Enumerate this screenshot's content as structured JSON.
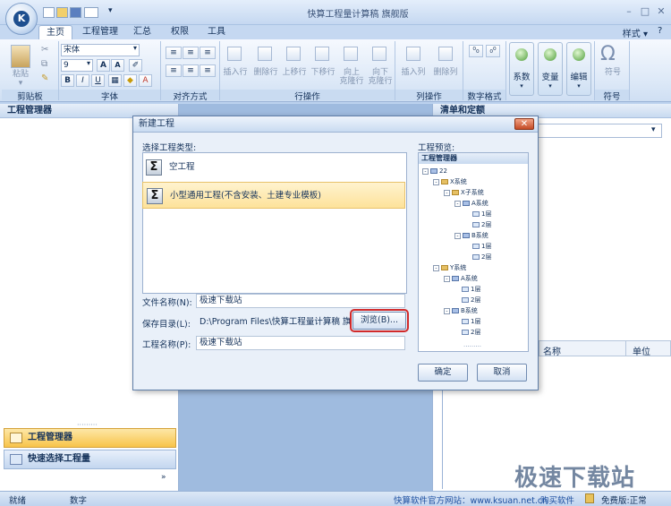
{
  "window": {
    "title": "快算工程量计算稿 旗舰版",
    "style_label": "样式"
  },
  "tabs": [
    "主页",
    "工程管理",
    "汇总",
    "权限",
    "工具"
  ],
  "ribbon": {
    "clipboard": {
      "paste": "粘贴",
      "group": "剪贴板"
    },
    "font": {
      "name": "宋体",
      "size": "9",
      "group": "字体"
    },
    "align": {
      "group": "对齐方式"
    },
    "rows": {
      "insert": "插入行",
      "delete": "删除行",
      "up": "上移行",
      "down": "下移行",
      "fill_up_1": "向上",
      "fill_up_2": "克隆行",
      "fill_down_1": "向下",
      "fill_down_2": "克隆行",
      "group": "行操作"
    },
    "cols": {
      "insert": "插入列",
      "delete": "删除列",
      "group": "列操作"
    },
    "numfmt": {
      "group": "数字格式"
    },
    "coef": "系数",
    "var": "变量",
    "edit": "编辑",
    "symbol": {
      "label": "符号",
      "group": "符号"
    }
  },
  "left_pane": {
    "title": "工程管理器",
    "nav1": "工程管理器",
    "nav2": "快速选择工程量"
  },
  "right_pane": {
    "title": "清单和定额",
    "col_name": "名称",
    "col_unit": "单位"
  },
  "dialog": {
    "title": "新建工程",
    "type_label": "选择工程类型:",
    "preview_label": "工程预览:",
    "types": [
      "空工程",
      "小型通用工程(不含安装、土建专业模板)"
    ],
    "file_label": "文件名称(N):",
    "file_value": "极速下载站",
    "dir_label": "保存目录(L):",
    "dir_value": "D:\\Program Files\\快算工程量计算稿 旗舰",
    "browse": "浏览(B)...",
    "proj_label": "工程名称(P):",
    "proj_value": "极速下载站",
    "ok": "确定",
    "cancel": "取消"
  },
  "tree": {
    "header": "工程管理器",
    "nodes": [
      "22",
      "X系统",
      "X子系统",
      "A系统",
      "1层",
      "2层",
      "B系统",
      "1层",
      "2层",
      "Y系统",
      "A系统",
      "1层",
      "2层",
      "B系统",
      "1层",
      "2层"
    ]
  },
  "status": {
    "ready": "就绪",
    "num": "数字",
    "site": "快算软件官方网站：www.ksuan.net.cn",
    "buy": "购买软件",
    "edition": "免费版:正常"
  },
  "watermark": "极速下载站"
}
